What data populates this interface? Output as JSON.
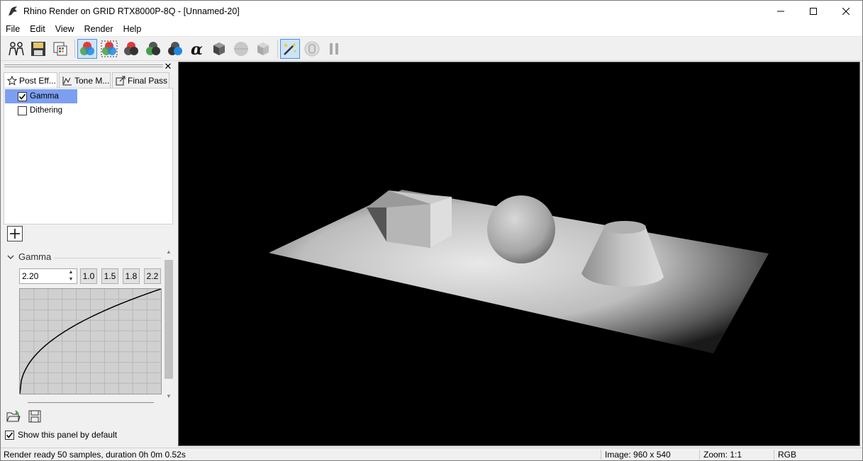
{
  "window": {
    "title": "Rhino Render on GRID RTX8000P-8Q - [Unnamed-20]",
    "minimize_icon": "minimize-icon",
    "maximize_icon": "maximize-icon",
    "close_icon": "close-icon"
  },
  "menu": [
    "File",
    "Edit",
    "View",
    "Render",
    "Help"
  ],
  "toolbar": {
    "buttons": [
      "render-window-icon",
      "save-icon",
      "clone-icon",
      "rgb-channels-icon",
      "rgb-inverted-icon",
      "red-channel-icon",
      "green-channel-icon",
      "blue-channel-icon",
      "alpha-channel-icon",
      "monochrome-icon",
      "sphere-icon",
      "cube-icon",
      "post-effects-wand-icon",
      "stop-icon",
      "pause-icon"
    ]
  },
  "panel": {
    "close_glyph": "✕",
    "tabs": [
      {
        "label": "Post Eff...",
        "icon": "star-icon"
      },
      {
        "label": "Tone M...",
        "icon": "graph-icon"
      },
      {
        "label": "Final Pass",
        "icon": "export-icon"
      }
    ],
    "effects": [
      {
        "label": "Gamma",
        "checked": true,
        "selected": true
      },
      {
        "label": "Dithering",
        "checked": false,
        "selected": false
      }
    ],
    "section_title": "Gamma",
    "gamma_value": "2.20",
    "presets": [
      "1.0",
      "1.5",
      "1.8",
      "2.2"
    ],
    "gamma_curve": 2.2,
    "show_default_label": "Show this panel by default",
    "show_default_checked": true
  },
  "status": {
    "message": "Render ready 50 samples, duration 0h 0m 0.52s",
    "image_size": "Image: 960 x 540",
    "zoom": "Zoom: 1:1",
    "channel": "RGB"
  }
}
